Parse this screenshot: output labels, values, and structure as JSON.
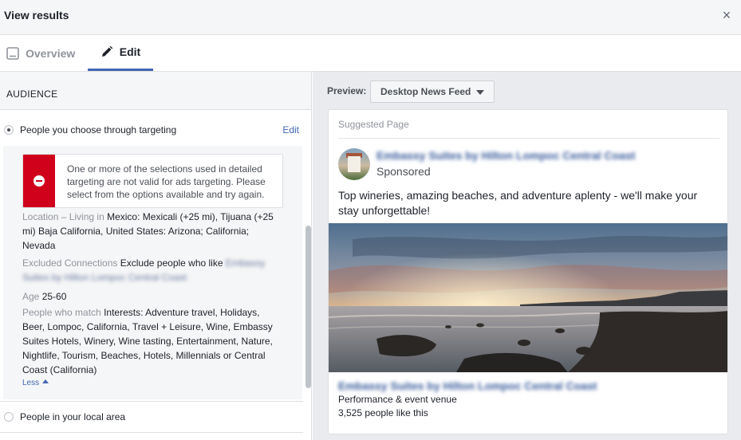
{
  "dialog": {
    "title": "View results",
    "close_glyph": "×"
  },
  "tabs": [
    {
      "label": "Overview",
      "icon": "tablet-icon",
      "active": false
    },
    {
      "label": "Edit",
      "icon": "pencil-icon",
      "active": true
    }
  ],
  "audience": {
    "section_title": "AUDIENCE",
    "option_targeting": {
      "label": "People you choose through targeting",
      "selected": true,
      "edit_label": "Edit"
    },
    "error_message": "One or more of the selections used in detailed targeting are not valid for ads targeting. Please select from the options available and try again.",
    "location": {
      "key": "Location – Living in",
      "value": "Mexico: Mexicali (+25 mi), Tijuana (+25 mi) Baja California, United States: Arizona; California; Nevada"
    },
    "excluded": {
      "key": "Excluded Connections",
      "value": "Exclude people who like",
      "blurred_value": "Embassy Suites by Hilton Lompoc Central Coast"
    },
    "age": {
      "key": "Age",
      "value": "25-60"
    },
    "people_match": {
      "key": "People who match",
      "value": "Interests: Adventure travel, Holidays, Beer, Lompoc, California, Travel + Leisure, Wine, Embassy Suites Hotels, Winery, Wine tasting, Entertainment, Nature, Nightlife, Tourism, Beaches, Hotels, Millennials or Central Coast (California)"
    },
    "less_label": "Less",
    "option_local": {
      "label": "People in your local area",
      "selected": false
    }
  },
  "preview": {
    "label": "Preview:",
    "placement": "Desktop News Feed",
    "card": {
      "suggested": "Suggested Page",
      "page_name": "Embassy Suites by Hilton Lompoc Central Coast",
      "sponsored": "Sponsored",
      "body": "Top wineries, amazing beaches, and adventure aplenty - we'll make your stay unforgettable!",
      "footer_title": "Embassy Suites by Hilton Lompoc Central Coast",
      "footer_category": "Performance & event venue",
      "footer_likes": "3,525 people like this"
    }
  },
  "colors": {
    "accent": "#4267b2",
    "error": "#d0021b",
    "link": "#365899",
    "panel_bg": "#e9ebee"
  }
}
